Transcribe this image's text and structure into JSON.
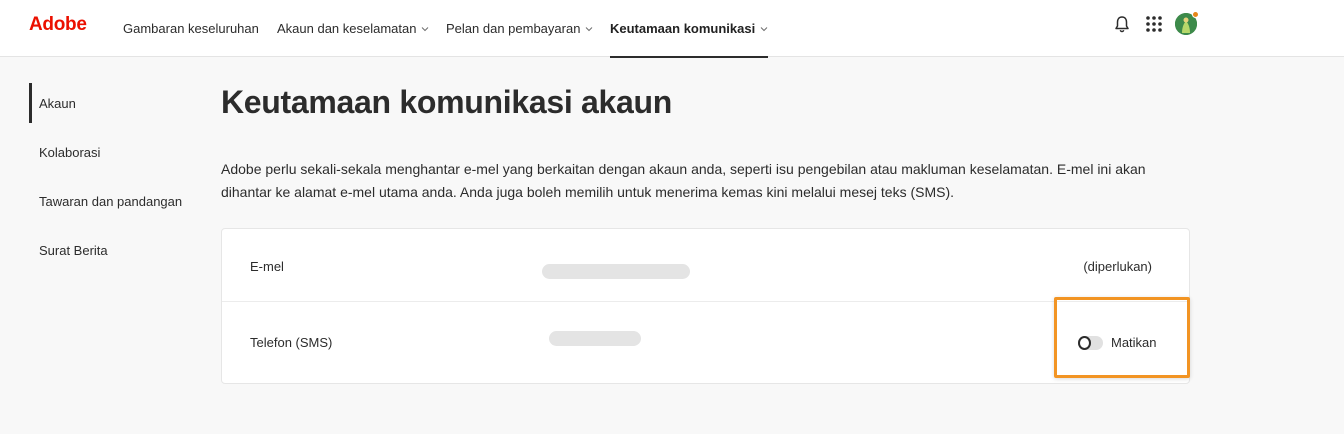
{
  "brand": {
    "name": "Adobe",
    "color": "#eb1000"
  },
  "nav": {
    "items": [
      {
        "label": "Gambaran keseluruhan",
        "has_dropdown": false,
        "active": false
      },
      {
        "label": "Akaun dan keselamatan",
        "has_dropdown": true,
        "active": false
      },
      {
        "label": "Pelan dan pembayaran",
        "has_dropdown": true,
        "active": false
      },
      {
        "label": "Keutamaan komunikasi",
        "has_dropdown": true,
        "active": true
      }
    ],
    "icons": [
      "bell-icon",
      "apps-grid-icon",
      "avatar"
    ]
  },
  "sidebar": {
    "items": [
      {
        "label": "Akaun",
        "active": true
      },
      {
        "label": "Kolaborasi",
        "active": false
      },
      {
        "label": "Tawaran dan pandangan",
        "active": false
      },
      {
        "label": "Surat Berita",
        "active": false
      }
    ]
  },
  "main": {
    "title": "Keutamaan komunikasi akaun",
    "description": "Adobe perlu sekali-sekala menghantar e-mel yang berkaitan dengan akaun anda, seperti isu pengebilan atau makluman keselamatan. E-mel ini akan dihantar ke alamat e-mel utama anda. Anda juga boleh memilih untuk menerima kemas kini melalui mesej teks (SMS).",
    "rows": [
      {
        "label": "E-mel",
        "value_redacted": true,
        "status": "(diperlukan)"
      },
      {
        "label": "Telefon (SMS)",
        "value_redacted": true,
        "toggle": {
          "on": false,
          "label": "Matikan"
        }
      }
    ]
  },
  "colors": {
    "highlight": "#f29423",
    "avatar_badge": "#e68619"
  }
}
